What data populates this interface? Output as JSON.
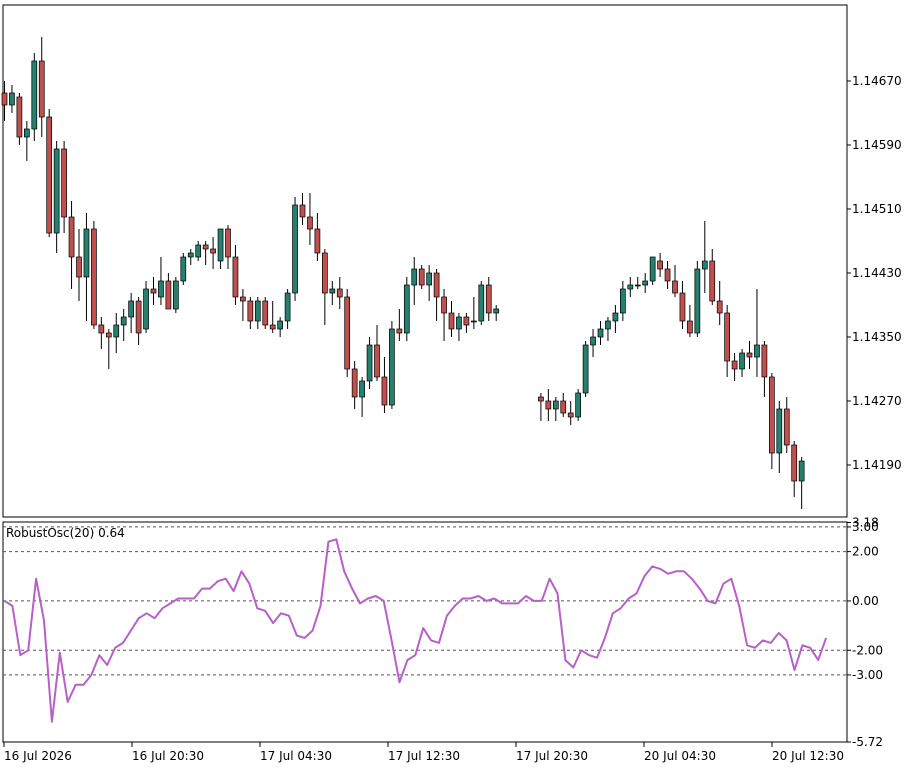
{
  "chart_data": [
    {
      "type": "candlestick",
      "panel": "price",
      "ylim": [
        1.14125,
        1.14765
      ],
      "y_ticks": [
        "1.14670",
        "1.14590",
        "1.14510",
        "1.14430",
        "1.14350",
        "1.14270",
        "1.14190"
      ],
      "x_tick_labels": [
        "16 Jul 2026",
        "16 Jul 20:30",
        "17 Jul 04:30",
        "17 Jul 12:30",
        "17 Jul 20:30",
        "20 Jul 04:30",
        "20 Jul 12:30"
      ],
      "colors": {
        "up": "#26806e",
        "down": "#c0504d",
        "wick": "#000000",
        "frame": "#000000"
      },
      "candles": [
        [
          1.14655,
          1.1467,
          1.1462,
          1.1464
        ],
        [
          1.1464,
          1.14665,
          1.1463,
          1.14655
        ],
        [
          1.1465,
          1.14655,
          1.1459,
          1.146
        ],
        [
          1.146,
          1.1462,
          1.1457,
          1.1461
        ],
        [
          1.1461,
          1.14705,
          1.14595,
          1.14695
        ],
        [
          1.14695,
          1.14725,
          1.146,
          1.14625
        ],
        [
          1.14625,
          1.14635,
          1.14475,
          1.1448
        ],
        [
          1.1448,
          1.14595,
          1.14455,
          1.14585
        ],
        [
          1.14585,
          1.14595,
          1.1448,
          1.145
        ],
        [
          1.145,
          1.1452,
          1.1441,
          1.1445
        ],
        [
          1.1445,
          1.14485,
          1.14395,
          1.14425
        ],
        [
          1.14425,
          1.14505,
          1.1437,
          1.14485
        ],
        [
          1.14485,
          1.14495,
          1.1436,
          1.14365
        ],
        [
          1.14365,
          1.14375,
          1.14335,
          1.14355
        ],
        [
          1.14355,
          1.1436,
          1.1431,
          1.1435
        ],
        [
          1.1435,
          1.1438,
          1.1433,
          1.14365
        ],
        [
          1.14365,
          1.14385,
          1.14345,
          1.14375
        ],
        [
          1.14375,
          1.14405,
          1.14355,
          1.14395
        ],
        [
          1.14395,
          1.144,
          1.1434,
          1.14355
        ],
        [
          1.1436,
          1.1442,
          1.14355,
          1.1441
        ],
        [
          1.1441,
          1.14425,
          1.1439,
          1.14405
        ],
        [
          1.144,
          1.1445,
          1.1439,
          1.1442
        ],
        [
          1.1442,
          1.1443,
          1.14385,
          1.14385
        ],
        [
          1.14385,
          1.14425,
          1.1438,
          1.1442
        ],
        [
          1.1442,
          1.14455,
          1.14415,
          1.1445
        ],
        [
          1.1445,
          1.1446,
          1.1444,
          1.14455
        ],
        [
          1.1445,
          1.1447,
          1.14445,
          1.14465
        ],
        [
          1.14465,
          1.1447,
          1.1444,
          1.1446
        ],
        [
          1.1446,
          1.14475,
          1.14435,
          1.14455
        ],
        [
          1.14445,
          1.14485,
          1.14435,
          1.14485
        ],
        [
          1.14485,
          1.1449,
          1.14435,
          1.1445
        ],
        [
          1.1445,
          1.14465,
          1.1439,
          1.144
        ],
        [
          1.144,
          1.1441,
          1.1437,
          1.14395
        ],
        [
          1.14395,
          1.144,
          1.1436,
          1.1437
        ],
        [
          1.1437,
          1.144,
          1.1436,
          1.14395
        ],
        [
          1.14395,
          1.144,
          1.1436,
          1.14365
        ],
        [
          1.14365,
          1.14395,
          1.14355,
          1.1436
        ],
        [
          1.1436,
          1.14375,
          1.1435,
          1.1437
        ],
        [
          1.1437,
          1.1441,
          1.1436,
          1.14405
        ],
        [
          1.14405,
          1.14525,
          1.14395,
          1.14515
        ],
        [
          1.14515,
          1.1453,
          1.1449,
          1.145
        ],
        [
          1.145,
          1.1453,
          1.14465,
          1.14485
        ],
        [
          1.14485,
          1.14505,
          1.14445,
          1.14455
        ],
        [
          1.14455,
          1.1446,
          1.14365,
          1.14405
        ],
        [
          1.14405,
          1.1442,
          1.1439,
          1.1441
        ],
        [
          1.1441,
          1.14425,
          1.14385,
          1.144
        ],
        [
          1.144,
          1.1441,
          1.143,
          1.1431
        ],
        [
          1.1431,
          1.1432,
          1.1426,
          1.14275
        ],
        [
          1.14275,
          1.143,
          1.1425,
          1.14295
        ],
        [
          1.14295,
          1.1435,
          1.14285,
          1.1434
        ],
        [
          1.1434,
          1.14365,
          1.14295,
          1.143
        ],
        [
          1.143,
          1.14325,
          1.14255,
          1.14265
        ],
        [
          1.14265,
          1.1437,
          1.1426,
          1.1436
        ],
        [
          1.1436,
          1.14385,
          1.14345,
          1.14355
        ],
        [
          1.14355,
          1.14425,
          1.14345,
          1.14415
        ],
        [
          1.14415,
          1.1445,
          1.1439,
          1.14435
        ],
        [
          1.14435,
          1.1444,
          1.1441,
          1.14415
        ],
        [
          1.14415,
          1.1444,
          1.14395,
          1.1443
        ],
        [
          1.1443,
          1.14435,
          1.1437,
          1.144
        ],
        [
          1.144,
          1.1441,
          1.14345,
          1.1438
        ],
        [
          1.1438,
          1.14395,
          1.1435,
          1.1436
        ],
        [
          1.1436,
          1.1438,
          1.14345,
          1.14375
        ],
        [
          1.14375,
          1.1438,
          1.14355,
          1.14365
        ],
        [
          1.1437,
          1.144,
          1.1436,
          1.1437
        ],
        [
          1.1437,
          1.1442,
          1.14365,
          1.14415
        ],
        [
          1.14415,
          1.14425,
          1.1437,
          1.1438
        ],
        [
          1.1438,
          1.1439,
          1.1437,
          1.14385
        ],
        null,
        null,
        null,
        null,
        null,
        [
          1.14275,
          1.1428,
          1.14245,
          1.1427
        ],
        [
          1.1427,
          1.14285,
          1.14245,
          1.1426
        ],
        [
          1.1426,
          1.14275,
          1.14245,
          1.1427
        ],
        [
          1.1427,
          1.1428,
          1.1425,
          1.14255
        ],
        [
          1.14255,
          1.1427,
          1.1424,
          1.1425
        ],
        [
          1.1425,
          1.14285,
          1.14245,
          1.1428
        ],
        [
          1.1428,
          1.14345,
          1.14275,
          1.1434
        ],
        [
          1.1434,
          1.1436,
          1.14325,
          1.1435
        ],
        [
          1.1435,
          1.1437,
          1.1434,
          1.1436
        ],
        [
          1.1436,
          1.14375,
          1.14345,
          1.1437
        ],
        [
          1.1437,
          1.1439,
          1.14355,
          1.1438
        ],
        [
          1.1438,
          1.1442,
          1.1437,
          1.1441
        ],
        [
          1.1441,
          1.14425,
          1.144,
          1.14415
        ],
        [
          1.14415,
          1.14425,
          1.1441,
          1.14415
        ],
        [
          1.14415,
          1.1443,
          1.14405,
          1.1442
        ],
        [
          1.1442,
          1.1445,
          1.14415,
          1.1445
        ],
        [
          1.14445,
          1.14455,
          1.14425,
          1.14435
        ],
        [
          1.14435,
          1.14445,
          1.1441,
          1.1442
        ],
        [
          1.1442,
          1.1444,
          1.144,
          1.14405
        ],
        [
          1.14405,
          1.1442,
          1.1436,
          1.1437
        ],
        [
          1.1437,
          1.1439,
          1.1435,
          1.14355
        ],
        [
          1.14355,
          1.14445,
          1.1435,
          1.14435
        ],
        [
          1.14435,
          1.14495,
          1.14405,
          1.14445
        ],
        [
          1.14445,
          1.1446,
          1.1439,
          1.14395
        ],
        [
          1.14395,
          1.1442,
          1.14365,
          1.1438
        ],
        [
          1.1438,
          1.1439,
          1.143,
          1.1432
        ],
        [
          1.1432,
          1.1433,
          1.14295,
          1.1431
        ],
        [
          1.1431,
          1.14335,
          1.143,
          1.1433
        ],
        [
          1.1433,
          1.14345,
          1.1431,
          1.14325
        ],
        [
          1.14325,
          1.1441,
          1.143,
          1.1434
        ],
        [
          1.1434,
          1.14345,
          1.14275,
          1.143
        ],
        [
          1.143,
          1.14305,
          1.14185,
          1.14205
        ],
        [
          1.14205,
          1.1427,
          1.1418,
          1.1426
        ],
        [
          1.1426,
          1.14275,
          1.14205,
          1.14215
        ],
        [
          1.14215,
          1.1422,
          1.1415,
          1.1417
        ],
        [
          1.1417,
          1.142,
          1.14135,
          1.14195
        ]
      ]
    },
    {
      "type": "line",
      "panel": "indicator",
      "title": "RobustOsc(20) 0.64",
      "ylim": [
        -5.72,
        3.2
      ],
      "y_ticks": [
        "3.18",
        "3.00",
        "2.00",
        "0.00",
        "-2.00",
        "-3.00",
        "-5.72"
      ],
      "levels": [
        3.0,
        2.0,
        0.0,
        -2.0,
        -3.0
      ],
      "color": "#b660c8",
      "values": [
        0.0,
        -0.2,
        -2.2,
        -2.0,
        0.9,
        -0.8,
        -4.9,
        -2.1,
        -4.1,
        -3.4,
        -3.4,
        -3.0,
        -2.2,
        -2.6,
        -1.9,
        -1.7,
        -1.2,
        -0.7,
        -0.5,
        -0.7,
        -0.3,
        -0.1,
        0.1,
        0.1,
        0.1,
        0.5,
        0.5,
        0.8,
        0.9,
        0.4,
        1.2,
        0.7,
        -0.3,
        -0.4,
        -0.9,
        -0.5,
        -0.6,
        -1.4,
        -1.5,
        -1.2,
        -0.2,
        2.4,
        2.5,
        1.2,
        0.5,
        -0.1,
        0.1,
        0.2,
        0.0,
        -1.6,
        -3.3,
        -2.4,
        -2.2,
        -1.1,
        -1.6,
        -1.7,
        -0.6,
        -0.2,
        0.1,
        0.1,
        0.2,
        0.0,
        0.1,
        -0.1,
        -0.1,
        -0.1,
        0.2,
        0.0,
        0.0,
        0.9,
        0.3,
        -2.4,
        -2.7,
        -2.0,
        -2.2,
        -2.3,
        -1.5,
        -0.5,
        -0.3,
        0.1,
        0.3,
        1.0,
        1.4,
        1.3,
        1.1,
        1.2,
        1.2,
        0.9,
        0.5,
        0.0,
        -0.1,
        0.7,
        0.9,
        -0.2,
        -1.8,
        -1.9,
        -1.6,
        -1.7,
        -1.3,
        -1.6,
        -2.8,
        -1.8,
        -1.9,
        -2.4,
        -1.5
      ]
    }
  ]
}
